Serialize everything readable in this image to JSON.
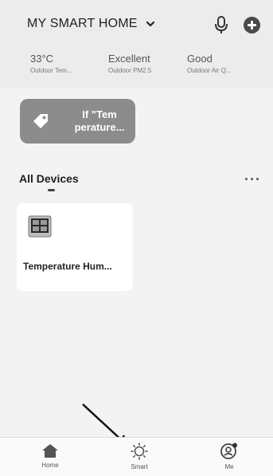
{
  "header": {
    "home_name": "MY SMART HOME"
  },
  "weather": [
    {
      "value": "33°C",
      "label": "Outdoor Tem..."
    },
    {
      "value": "Excellent",
      "label": "Outdoor PM2.5"
    },
    {
      "value": "Good",
      "label": "Outdoor Air Q..."
    }
  ],
  "scene": {
    "line1": "If \"Tem",
    "line2": "perature..."
  },
  "devices": {
    "section_title": "All Devices",
    "items": [
      {
        "name": "Temperature Hum..."
      }
    ]
  },
  "tabs": [
    {
      "label": "Home"
    },
    {
      "label": "Smart"
    },
    {
      "label": "Me"
    }
  ],
  "colors": {
    "scene_card": "#8c8c8c",
    "background": "#f3f3f3"
  }
}
